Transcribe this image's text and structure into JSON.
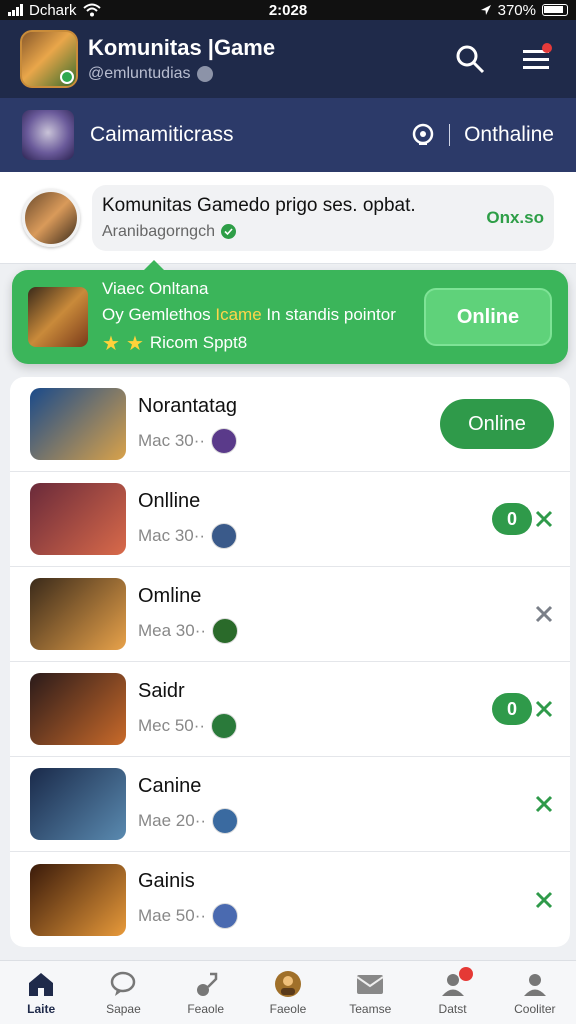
{
  "status_bar": {
    "carrier": "Dchark",
    "time": "2:028",
    "battery": "370%"
  },
  "header": {
    "title": "Komunitas |Game",
    "subtitle": "@emluntudias"
  },
  "subheader": {
    "label": "Caimamiticrass",
    "status": "Onthaline"
  },
  "message": {
    "text": "Komunitas Gamedo prigo ses. opbat.",
    "sub": "Aranibagorngch",
    "status": "Onx.so"
  },
  "banner": {
    "line1": "Viaec Onltana",
    "line2_pre": "Oy Gemlethos ",
    "line2_hl": "Icame",
    "line2_post": " In standis pointor",
    "line3": "Ricom Sppt8",
    "button": "Online"
  },
  "list": [
    {
      "name": "Norantatag",
      "meta": "Mac 30··",
      "action_type": "big",
      "action_label": "Online",
      "thumb_colors": [
        "#1a4a8a",
        "#d9a24a"
      ],
      "mini_color": "#5a3a8a"
    },
    {
      "name": "Onlline",
      "meta": "Mac 30··",
      "action_type": "small",
      "action_label": "0",
      "thumb_colors": [
        "#6a2a3a",
        "#d96a4a"
      ],
      "mini_color": "#3a5a8a"
    },
    {
      "name": "Omline",
      "meta": "Mea 30··",
      "action_type": "icon",
      "action_label": "",
      "thumb_colors": [
        "#3a2a1a",
        "#e8a24a"
      ],
      "mini_color": "#2a6a2a"
    },
    {
      "name": "Saidr",
      "meta": "Mec 50··",
      "action_type": "small",
      "action_label": "0",
      "thumb_colors": [
        "#2a1a1a",
        "#c96a2a"
      ],
      "mini_color": "#2a7a3a"
    },
    {
      "name": "Canine",
      "meta": "Mae 20··",
      "action_type": "icon-green",
      "action_label": "",
      "thumb_colors": [
        "#1a2a4a",
        "#5a8ab0"
      ],
      "mini_color": "#3a6aa0"
    },
    {
      "name": "Gainis",
      "meta": "Mae 50··",
      "action_type": "icon-green",
      "action_label": "",
      "thumb_colors": [
        "#3a1a0a",
        "#e89a3a"
      ],
      "mini_color": "#4a6ab0"
    }
  ],
  "nav": [
    {
      "label": "Laite",
      "icon": "home-icon",
      "active": true
    },
    {
      "label": "Sapae",
      "icon": "chat-icon",
      "active": false
    },
    {
      "label": "Feaole",
      "icon": "guitar-icon",
      "active": false
    },
    {
      "label": "Faeole",
      "icon": "avatar-icon",
      "active": false
    },
    {
      "label": "Teamse",
      "icon": "mail-icon",
      "active": false
    },
    {
      "label": "Datst",
      "icon": "profile-icon",
      "active": false,
      "badge": true
    },
    {
      "label": "Cooliter",
      "icon": "user-icon",
      "active": false
    }
  ]
}
